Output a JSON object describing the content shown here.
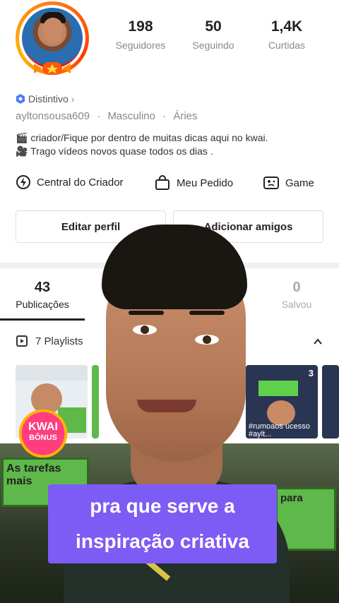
{
  "profile": {
    "stats": [
      {
        "value": "198",
        "label": "Seguidores"
      },
      {
        "value": "50",
        "label": "Seguindo"
      },
      {
        "value": "1,4K",
        "label": "Curtidas"
      }
    ],
    "distintivo": "Distintivo",
    "username": "ayltonsousa609",
    "gender": "Masculino",
    "sign": "Áries",
    "bio_line1": "criador/Fique por dentro de muitas dicas aqui no kwai.",
    "bio_line2": "Trago vídeos novos  quase todos os dias ."
  },
  "tools": [
    {
      "label": "Central do Criador",
      "icon": "creator-center-icon"
    },
    {
      "label": "Meu Pedido",
      "icon": "shopping-bag-icon"
    },
    {
      "label": "Game",
      "icon": "game-icon"
    }
  ],
  "buttons": {
    "edit": "Editar perfil",
    "add_friends": "Adicionar amigos"
  },
  "tabs": [
    {
      "count": "43",
      "label": "Publicações"
    },
    {
      "count": "0",
      "label": "Salvou"
    }
  ],
  "playlists": {
    "label": "7 Playlists",
    "thumb_count": "3",
    "thumb_caption": "#rumoaos ucesso #aylt..."
  },
  "overlay": {
    "kwai_line1": "KWAI",
    "kwai_line2": "BÔNUS",
    "caption_line1": "pra que serve a",
    "caption_line2": "inspiração criativa",
    "board_left": "As tarefas mais",
    "board_right": "para"
  },
  "colors": {
    "caption_bg": "#7c5cf4",
    "avatar_ring": "#ff7a1a"
  }
}
